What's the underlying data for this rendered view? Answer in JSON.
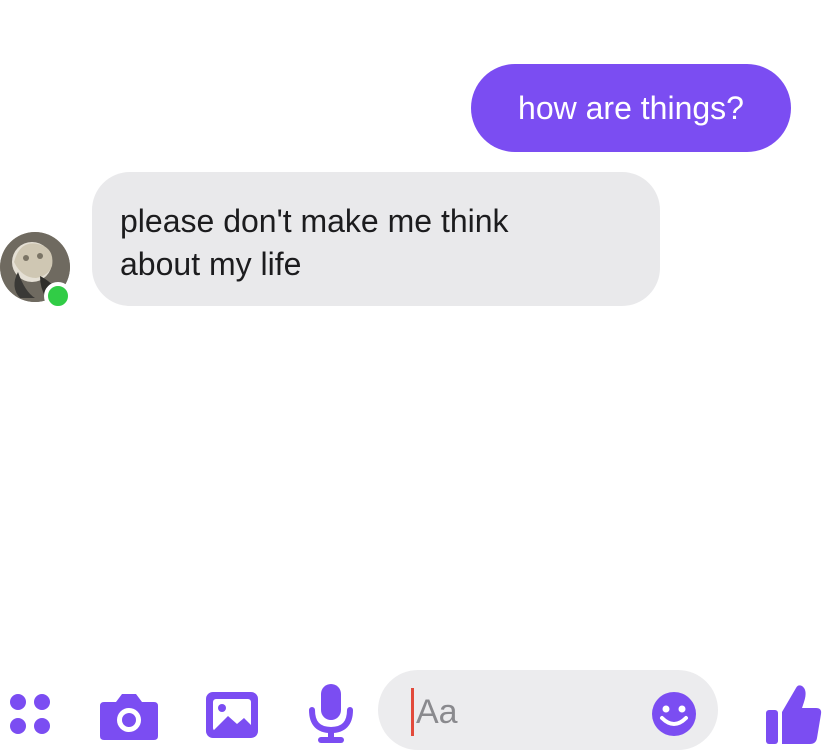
{
  "messages": {
    "outgoing": "how are things?",
    "incoming_line1": "please don't make me think",
    "incoming_line2": "about my life"
  },
  "composer": {
    "placeholder": "Aa"
  },
  "icons": {
    "menu": "four-dots-icon",
    "camera": "camera-icon",
    "gallery": "image-icon",
    "mic": "microphone-icon",
    "emoji": "emoji-icon",
    "like": "thumbs-up-icon"
  },
  "colors": {
    "accent": "#7b4df2",
    "incoming_bubble": "#e9e9eb",
    "online": "#31cc46"
  }
}
